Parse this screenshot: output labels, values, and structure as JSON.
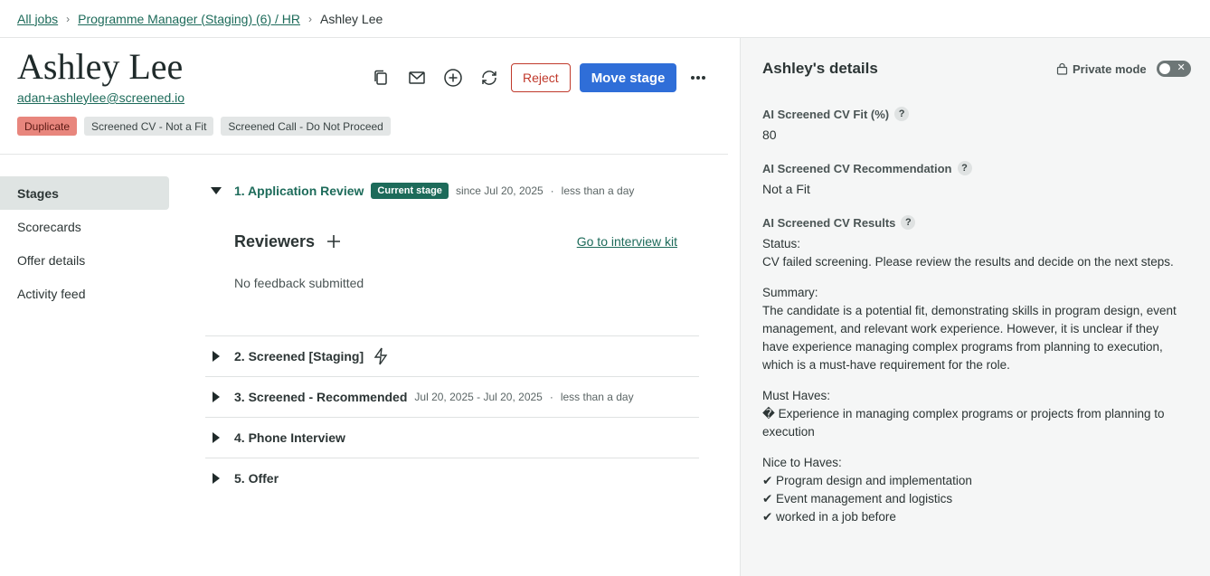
{
  "breadcrumb": {
    "all_jobs": "All jobs",
    "job": "Programme Manager (Staging) (6) / HR",
    "current": "Ashley Lee"
  },
  "candidate": {
    "name": "Ashley Lee",
    "email": "adan+ashleylee@screened.io",
    "tags": [
      "Duplicate",
      "Screened CV - Not a Fit",
      "Screened Call - Do Not Proceed"
    ]
  },
  "actions": {
    "copy_icon": "copy-icon",
    "email_icon": "mail-icon",
    "add_icon": "plus-circle-icon",
    "refresh_icon": "refresh-icon",
    "reject": "Reject",
    "move_stage": "Move stage",
    "more_icon": "more-icon"
  },
  "nav": {
    "items": [
      "Stages",
      "Scorecards",
      "Offer details",
      "Activity feed"
    ],
    "active": "Stages"
  },
  "stages": {
    "current": {
      "title": "1. Application Review",
      "badge": "Current stage",
      "since": "since Jul 20, 2025",
      "duration": "less than a day",
      "reviewers_title": "Reviewers",
      "interview_kit": "Go to interview kit",
      "no_feedback": "No feedback submitted"
    },
    "others": [
      {
        "title": "2. Screened [Staging]",
        "dates": "",
        "duration": ""
      },
      {
        "title": "3. Screened - Recommended",
        "dates": "Jul 20, 2025 - Jul 20, 2025",
        "duration": "less than a day"
      },
      {
        "title": "4. Phone Interview",
        "dates": "",
        "duration": ""
      },
      {
        "title": "5. Offer",
        "dates": "",
        "duration": ""
      }
    ]
  },
  "details": {
    "title": "Ashley's details",
    "private_mode": "Private mode",
    "private_mode_on": false,
    "fit_label": "AI Screened CV Fit (%)",
    "fit_value": "80",
    "rec_label": "AI Screened CV Recommendation",
    "rec_value": "Not a Fit",
    "results_label": "AI Screened CV Results",
    "status_label": "Status:",
    "status_text": "CV failed screening. Please review the results and decide on the next steps.",
    "summary_label": "Summary:",
    "summary_text": "The candidate is a potential fit, demonstrating skills in program design, event management, and relevant work experience. However, it is unclear if they have experience managing complex programs from planning to execution, which is a must-have requirement for the role.",
    "must_label": "Must Haves:",
    "must_items": [
      "� Experience in managing complex programs or projects from planning to execution"
    ],
    "nice_label": "Nice to Haves:",
    "nice_items": [
      "✔ Program design and implementation",
      "✔ Event management and logistics",
      "✔ worked in a job before"
    ]
  },
  "colors": {
    "accent": "#1d6b5a",
    "primary_button": "#2f6ed8",
    "reject": "#c0392b",
    "duplicate_tag": "#e8867d"
  }
}
